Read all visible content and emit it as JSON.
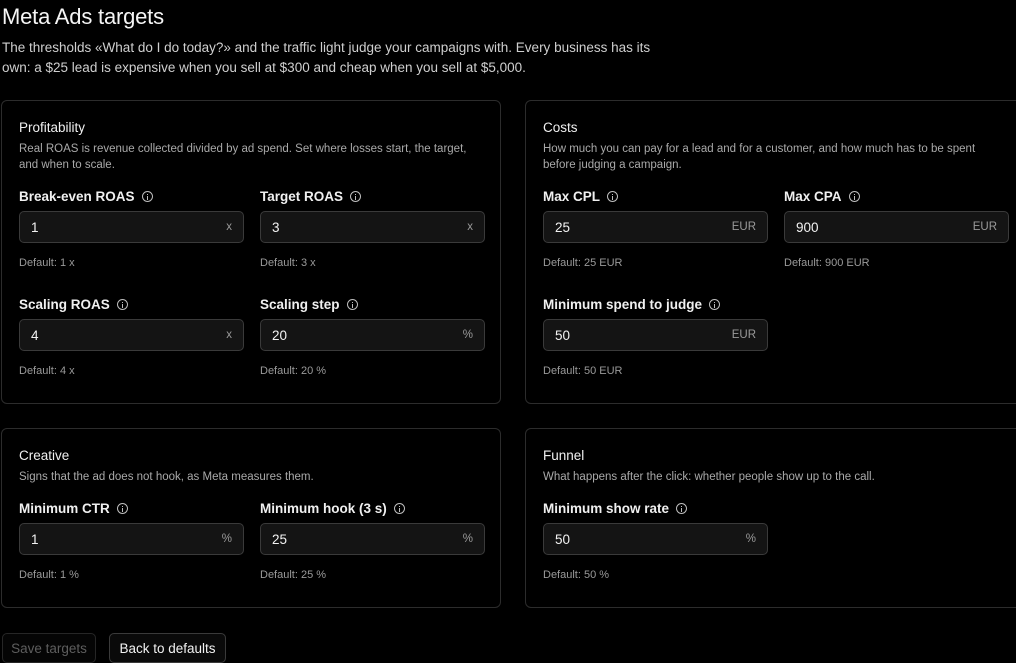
{
  "header": {
    "title": "Meta Ads targets",
    "description": "The thresholds «What do I do today?» and the traffic light judge your campaigns with. Every business has its own: a $25 lead is expensive when you sell at $300 and cheap when you sell at $5,000."
  },
  "cards": {
    "profitability": {
      "title": "Profitability",
      "description": "Real ROAS is revenue collected divided by ad spend. Set where losses start, the target, and when to scale.",
      "fields": [
        {
          "label": "Break-even ROAS",
          "value": "1",
          "unit": "x",
          "default": "Default: 1 x"
        },
        {
          "label": "Target ROAS",
          "value": "3",
          "unit": "x",
          "default": "Default: 3 x"
        },
        {
          "label": "Scaling ROAS",
          "value": "4",
          "unit": "x",
          "default": "Default: 4 x"
        },
        {
          "label": "Scaling step",
          "value": "20",
          "unit": "%",
          "default": "Default: 20 %"
        }
      ]
    },
    "costs": {
      "title": "Costs",
      "description": "How much you can pay for a lead and for a customer, and how much has to be spent before judging a campaign.",
      "fields": [
        {
          "label": "Max CPL",
          "value": "25",
          "unit": "EUR",
          "default": "Default: 25 EUR"
        },
        {
          "label": "Max CPA",
          "value": "900",
          "unit": "EUR",
          "default": "Default: 900 EUR"
        },
        {
          "label": "Minimum spend to judge",
          "value": "50",
          "unit": "EUR",
          "default": "Default: 50 EUR"
        }
      ]
    },
    "creative": {
      "title": "Creative",
      "description": "Signs that the ad does not hook, as Meta measures them.",
      "fields": [
        {
          "label": "Minimum CTR",
          "value": "1",
          "unit": "%",
          "default": "Default: 1 %"
        },
        {
          "label": "Minimum hook (3 s)",
          "value": "25",
          "unit": "%",
          "default": "Default: 25 %"
        }
      ]
    },
    "funnel": {
      "title": "Funnel",
      "description": "What happens after the click: whether people show up to the call.",
      "fields": [
        {
          "label": "Minimum show rate",
          "value": "50",
          "unit": "%",
          "default": "Default: 50 %"
        }
      ]
    }
  },
  "actions": {
    "save_label": "Save targets",
    "reset_label": "Back to defaults"
  },
  "icons": {
    "field_help": "info-icon"
  }
}
